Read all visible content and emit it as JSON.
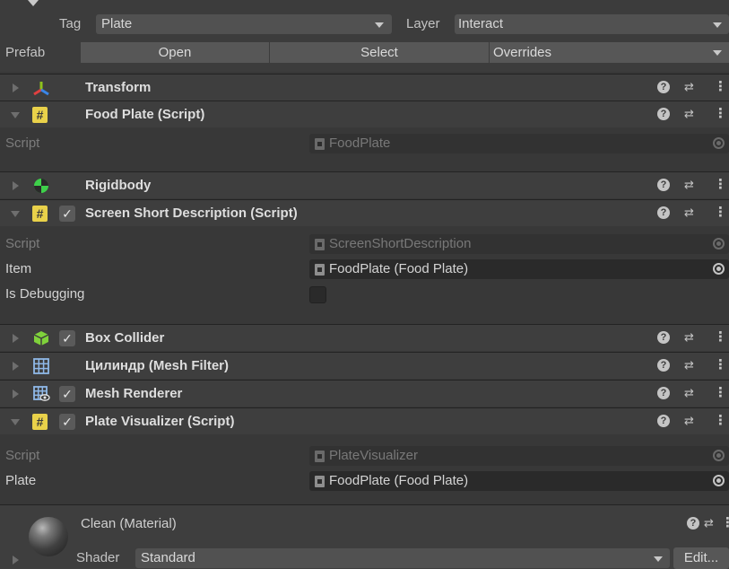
{
  "header": {
    "tag_label": "Tag",
    "tag_value": "Plate",
    "layer_label": "Layer",
    "layer_value": "Interact",
    "prefab_label": "Prefab",
    "open_label": "Open",
    "select_label": "Select",
    "overrides_label": "Overrides"
  },
  "components": {
    "transform": {
      "title": "Transform"
    },
    "food_plate": {
      "title": "Food Plate (Script)",
      "script_label": "Script",
      "script_value": "FoodPlate"
    },
    "rigidbody": {
      "title": "Rigidbody"
    },
    "screen_short": {
      "title": "Screen Short Description (Script)",
      "script_label": "Script",
      "script_value": "ScreenShortDescription",
      "item_label": "Item",
      "item_value": "FoodPlate (Food Plate)",
      "debug_label": "Is Debugging",
      "is_debugging": false
    },
    "box_collider": {
      "title": "Box Collider"
    },
    "mesh_filter": {
      "title": "Цилиндр (Mesh Filter)"
    },
    "mesh_renderer": {
      "title": "Mesh Renderer"
    },
    "plate_visualizer": {
      "title": "Plate Visualizer (Script)",
      "script_label": "Script",
      "script_value": "PlateVisualizer",
      "plate_label": "Plate",
      "plate_value": "FoodPlate (Food Plate)"
    }
  },
  "material": {
    "title": "Clean (Material)",
    "shader_label": "Shader",
    "shader_value": "Standard",
    "edit_label": "Edit..."
  },
  "icons": {
    "help": "?",
    "preset": "⇄",
    "kebab": "⋮",
    "check": "✓",
    "script": "#"
  },
  "colors": {
    "background": "#383838",
    "header_bg": "#3e3e3e",
    "script_icon": "#e9d14a",
    "rigidbody_icon": "#3ed04a",
    "box_collider_icon": "#7fd13b",
    "mesh_icon": "#8fb8e8",
    "transform_icon_y": "#8ec21c",
    "transform_icon_x": "#e04040",
    "transform_icon_z": "#3a86e8"
  }
}
